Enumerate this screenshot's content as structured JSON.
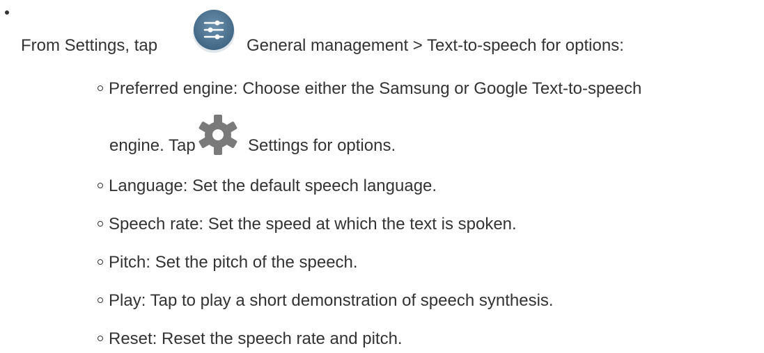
{
  "intro": {
    "before_icon": "From Settings, tap",
    "icon": "general-management-icon",
    "after_icon": "General management > Text-to-speech for options:"
  },
  "options": [
    {
      "text": "Preferred engine: Choose either the Samsung or Google Text-to-speech"
    },
    {
      "cont_before": "engine. Tap",
      "icon": "gear-icon",
      "cont_after": "Settings for options."
    },
    {
      "text": "Language: Set the default speech language."
    },
    {
      "text": "Speech rate: Set the speed at which the text is spoken."
    },
    {
      "text": "Pitch: Set the pitch of the speech."
    },
    {
      "text": "Play: Tap to play a short demonstration of speech synthesis."
    },
    {
      "text": "Reset: Reset the speech rate and pitch."
    }
  ],
  "colors": {
    "text": "#333333",
    "icon_blue": "#4f7796",
    "gear_gray": "#7a7a7a"
  }
}
